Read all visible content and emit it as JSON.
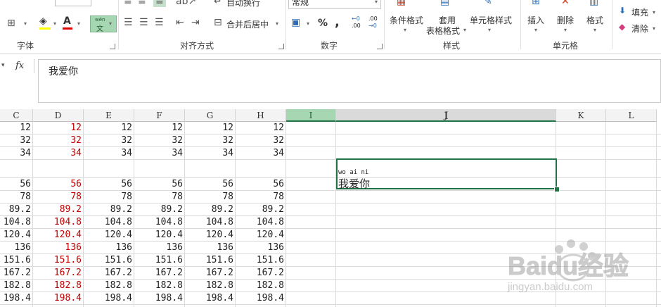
{
  "ribbon": {
    "groups": [
      "字体",
      "对齐方式",
      "数字",
      "样式",
      "单元格"
    ],
    "wrap_text": "自动换行",
    "merge_center": "合并后居中",
    "number_format": "常规",
    "conditional_format": "条件格式",
    "table_format_line1": "套用",
    "table_format_line2": "表格格式",
    "cell_styles": "单元格样式",
    "insert": "插入",
    "delete": "删除",
    "format": "格式",
    "fill": "填充",
    "clear": "清除",
    "phonetic_top": "wén",
    "phonetic_bottom": "文",
    "percent": "%",
    "comma": ",",
    "inc_decimal": ".00",
    "dec_decimal": ".00"
  },
  "formula_bar": {
    "fx": "fx",
    "content": "我爱你"
  },
  "grid": {
    "columns": [
      "C",
      "D",
      "E",
      "F",
      "G",
      "H",
      "I",
      "J",
      "K",
      "L"
    ],
    "rows": [
      [
        "12",
        "12",
        "12",
        "12",
        "12",
        "12"
      ],
      [
        "32",
        "32",
        "32",
        "32",
        "32",
        "32"
      ],
      [
        "34",
        "34",
        "34",
        "34",
        "34",
        "34"
      ],
      [
        "",
        "",
        "",
        "",
        "",
        ""
      ],
      [
        "56",
        "56",
        "56",
        "56",
        "56",
        "56"
      ],
      [
        "78",
        "78",
        "78",
        "78",
        "78",
        "78"
      ],
      [
        "89.2",
        "89.2",
        "89.2",
        "89.2",
        "89.2",
        "89.2"
      ],
      [
        "104.8",
        "104.8",
        "104.8",
        "104.8",
        "104.8",
        "104.8"
      ],
      [
        "120.4",
        "120.4",
        "120.4",
        "120.4",
        "120.4",
        "120.4"
      ],
      [
        "136",
        "136",
        "136",
        "136",
        "136",
        "136"
      ],
      [
        "151.6",
        "151.6",
        "151.6",
        "151.6",
        "151.6",
        "151.6"
      ],
      [
        "167.2",
        "167.2",
        "167.2",
        "167.2",
        "167.2",
        "167.2"
      ],
      [
        "182.8",
        "182.8",
        "182.8",
        "182.8",
        "182.8",
        "182.8"
      ],
      [
        "198.4",
        "198.4",
        "198.4",
        "198.4",
        "198.4",
        "198.4"
      ]
    ],
    "red_column": "D",
    "active_cell": {
      "pinyin": "wo ai ni",
      "text": "我爱你"
    }
  },
  "watermark": {
    "text_main": "Baidu经验",
    "text_url": "jingyan.baidu.com"
  },
  "colors": {
    "accent": "#217346",
    "red_text": "#c00000",
    "selected_col": "#a6d6b2"
  }
}
